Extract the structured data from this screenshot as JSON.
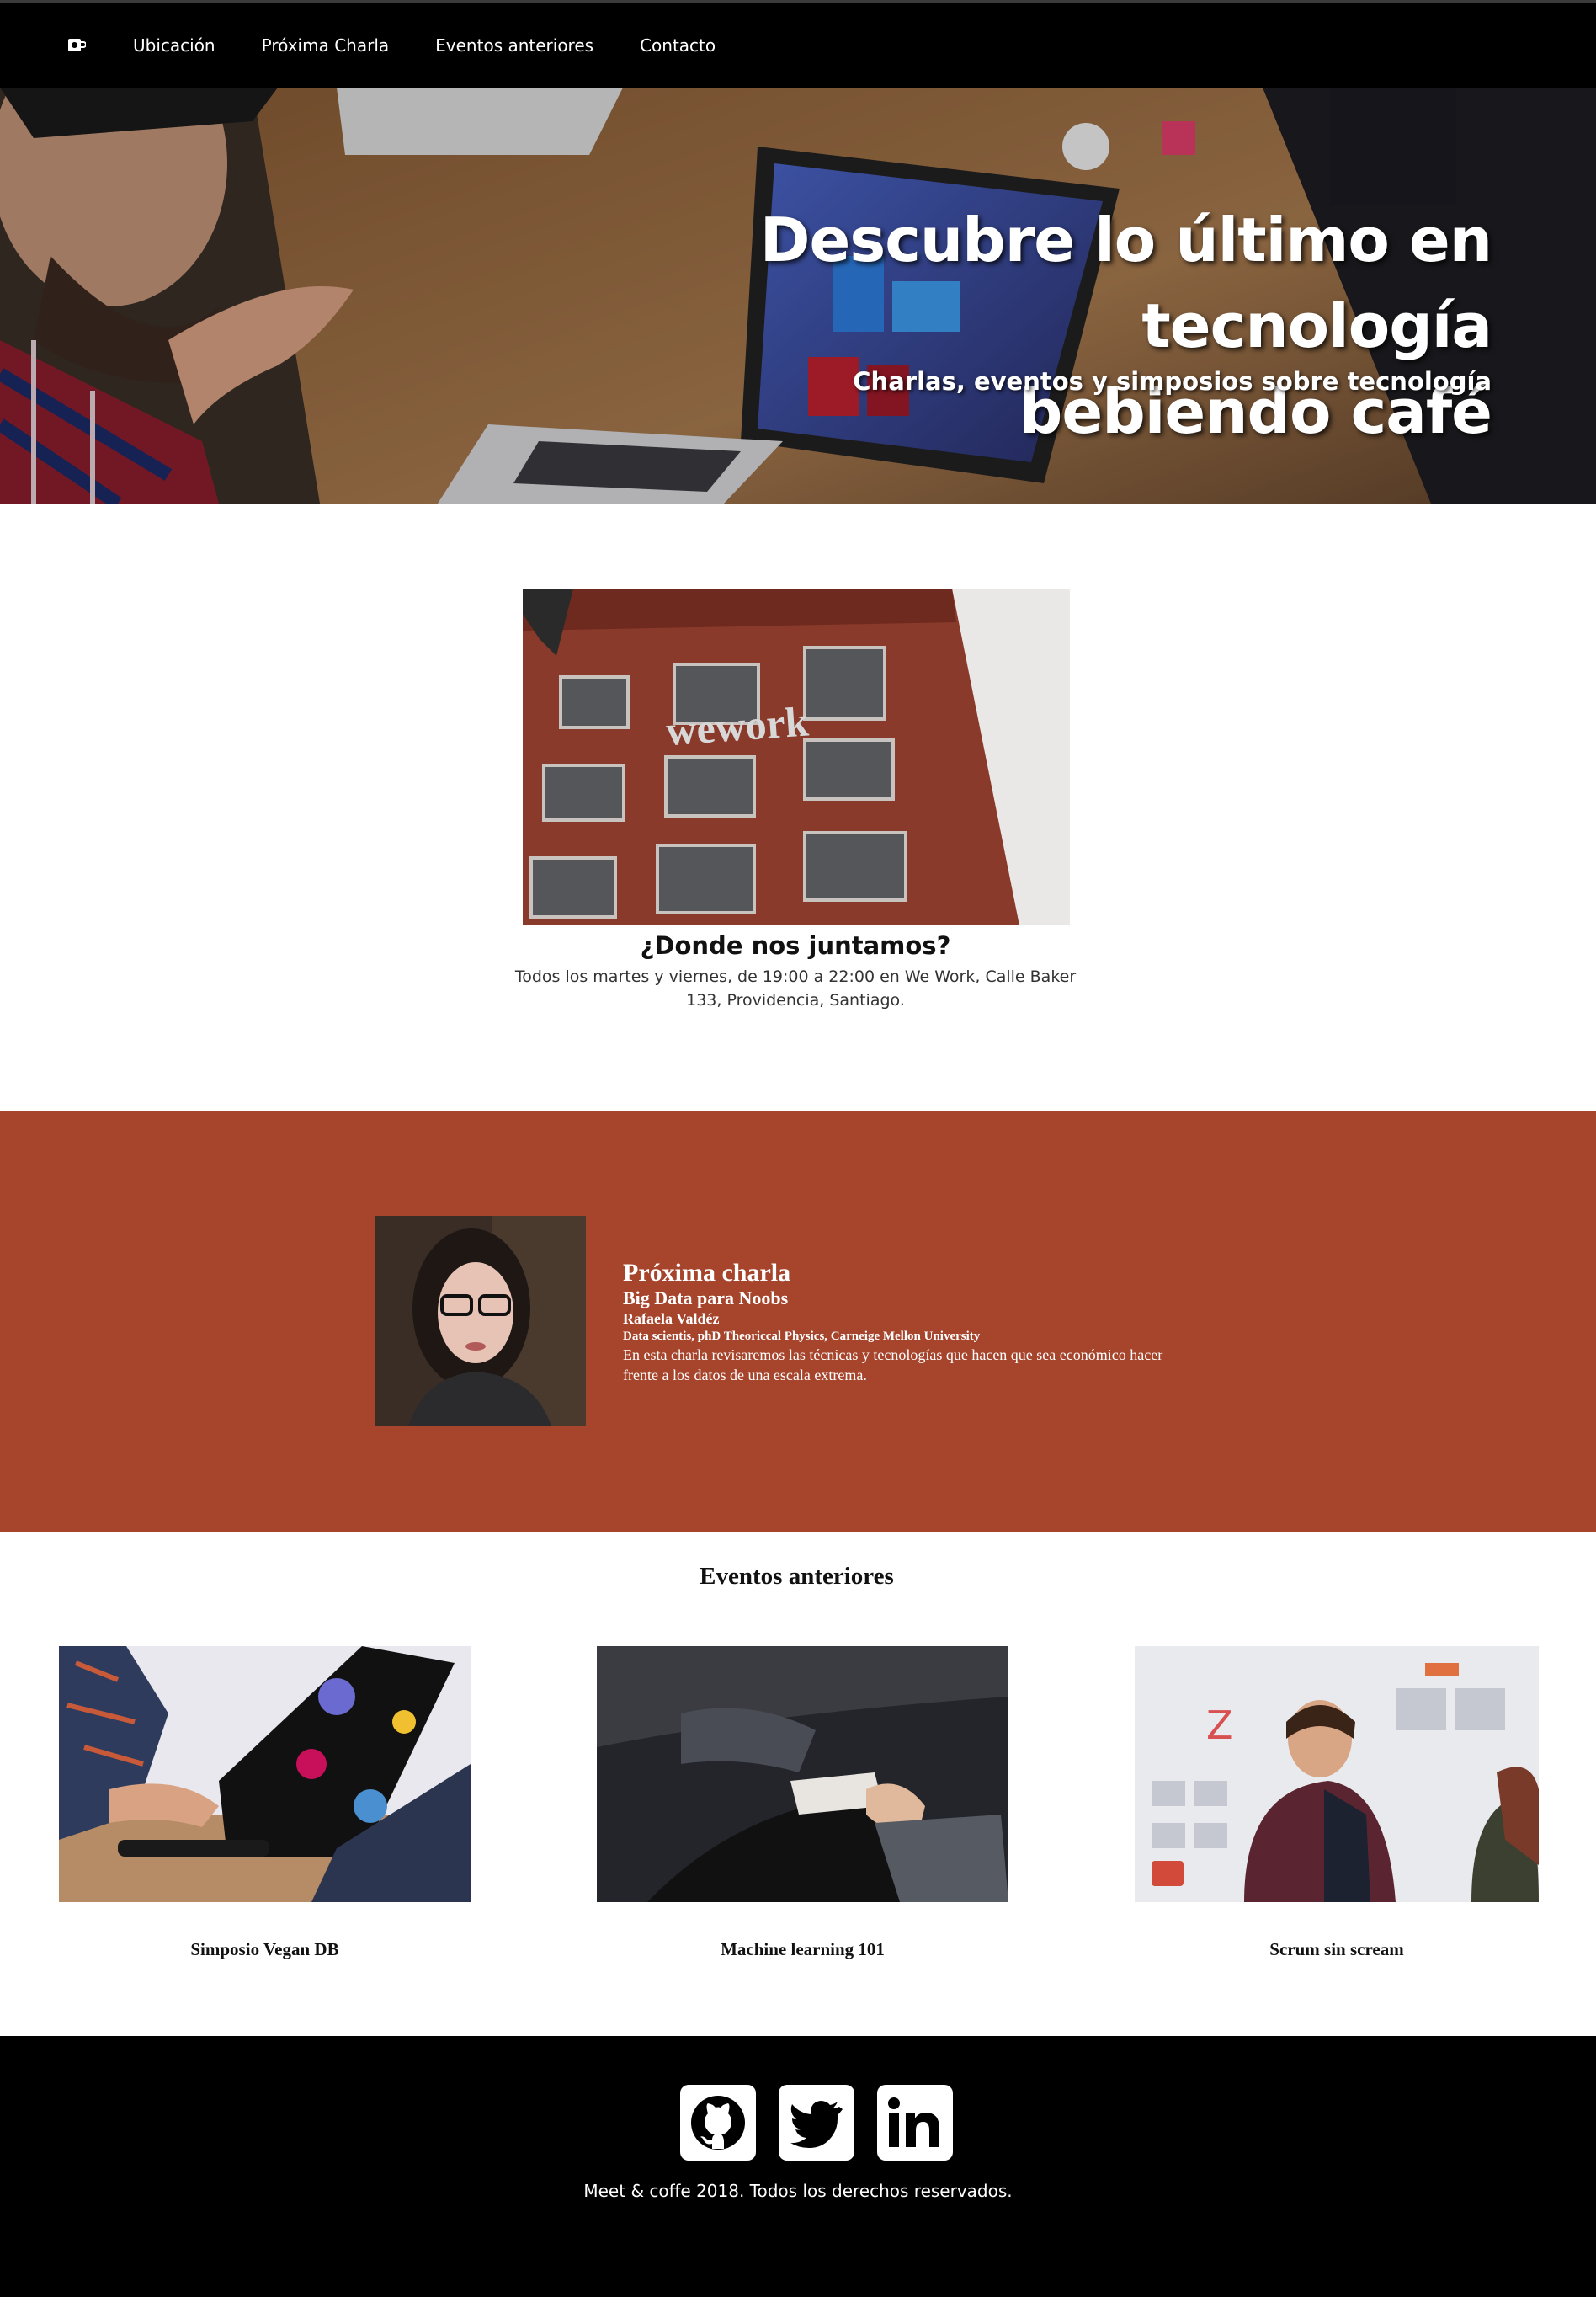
{
  "nav": {
    "logo_icon": "coffee-cup-icon",
    "items": [
      {
        "label": "Ubicación"
      },
      {
        "label": "Próxima Charla"
      },
      {
        "label": "Eventos anteriores"
      },
      {
        "label": "Contacto"
      }
    ]
  },
  "hero": {
    "title_line1": "Descubre lo último en tecnología",
    "title_line2": "bebiendo café",
    "subtitle": "Charlas, eventos y simposios sobre tecnología"
  },
  "location": {
    "image_text": "wework",
    "title": "¿Donde nos juntamos?",
    "description": "Todos los martes y viernes, de 19:00 a 22:00 en We Work, Calle Baker 133, Providencia, Santiago."
  },
  "next_talk": {
    "heading": "Próxima charla",
    "talk_title": "Big Data para Noobs",
    "speaker": "Rafaela Valdéz",
    "speaker_bio": "Data scientis, phD Theoriccal Physics, Carneige Mellon University",
    "description": "En esta charla revisaremos las técnicas y tecnologías que hacen que sea económico hacer frente a los datos de una escala extrema.",
    "accent_color": "#a6442c"
  },
  "past_events": {
    "title": "Eventos anteriores",
    "items": [
      {
        "caption": "Simposio Vegan DB"
      },
      {
        "caption": "Machine learning 101"
      },
      {
        "caption": "Scrum sin scream"
      }
    ]
  },
  "footer": {
    "social": [
      {
        "icon": "github-icon"
      },
      {
        "icon": "twitter-icon"
      },
      {
        "icon": "linkedin-icon"
      }
    ],
    "copyright": "Meet & coffe 2018. Todos los derechos reservados."
  }
}
